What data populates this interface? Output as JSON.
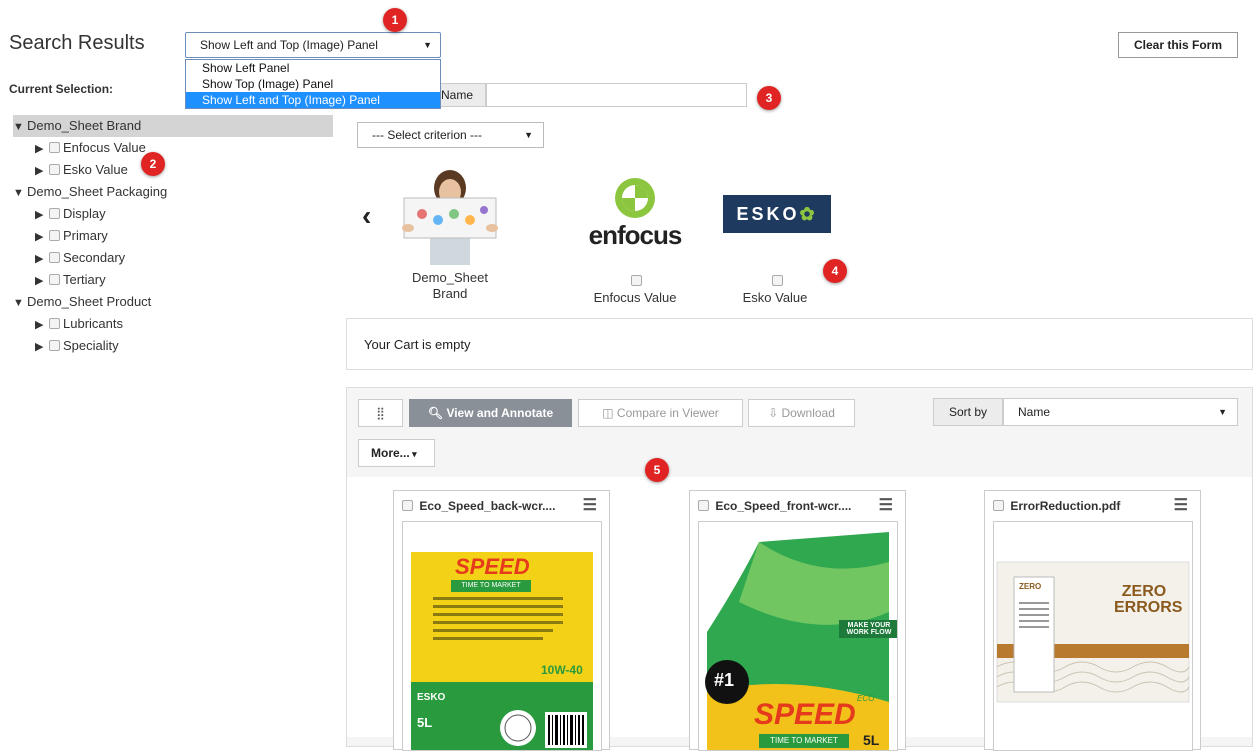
{
  "header": {
    "title": "Search Results",
    "panel_select_value": "Show Left and Top (Image) Panel",
    "panel_options": [
      "Show Left Panel",
      "Show Top (Image) Panel",
      "Show Left and Top (Image) Panel"
    ],
    "clear_button": "Clear this Form"
  },
  "badges": [
    "1",
    "2",
    "3",
    "4",
    "5"
  ],
  "sidebar": {
    "current_selection_label": "Current Selection:",
    "groups": [
      {
        "label": "Demo_Sheet Brand",
        "items": [
          "Enfocus Value",
          "Esko Value"
        ]
      },
      {
        "label": "Demo_Sheet Packaging",
        "items": [
          "Display",
          "Primary",
          "Secondary",
          "Tertiary"
        ]
      },
      {
        "label": "Demo_Sheet Product",
        "items": [
          "Lubricants",
          "Speciality"
        ]
      }
    ]
  },
  "search": {
    "name_label": "Name",
    "name_value": "",
    "criterion_placeholder": "--- Select criterion ---"
  },
  "facets": {
    "brand_line1": "Demo_Sheet",
    "brand_line2": "Brand",
    "enfocus_logo_text": "enfocus",
    "esko_logo_text": "ESKO",
    "enfocus_label": "Enfocus Value",
    "esko_label": "Esko Value"
  },
  "cart": {
    "text": "Your Cart is empty"
  },
  "toolbar": {
    "view_annotate": "View and Annotate",
    "compare": "Compare in Viewer",
    "download": "Download",
    "sort_by_label": "Sort by",
    "sort_by_value": "Name",
    "more": "More..."
  },
  "assets": [
    {
      "name": "Eco_Speed_back-wcr....",
      "texts": [
        "SPEED",
        "TIME TO MARKET",
        "10W-40",
        "ESKO",
        "5L"
      ]
    },
    {
      "name": "Eco_Speed_front-wcr....",
      "texts": [
        "MAKE YOUR WORK FLOW",
        "#1",
        "SPEED",
        "ECO",
        "TIME TO MARKET",
        "5L"
      ]
    },
    {
      "name": "ErrorReduction.pdf",
      "texts": [
        "ZERO ERRORS",
        "ZERO"
      ]
    }
  ],
  "colors": {
    "badge": "#e02424",
    "selected_option": "#1e90ff",
    "enfocus_green": "#8cc63f",
    "esko_navy": "#1f3a5f"
  }
}
